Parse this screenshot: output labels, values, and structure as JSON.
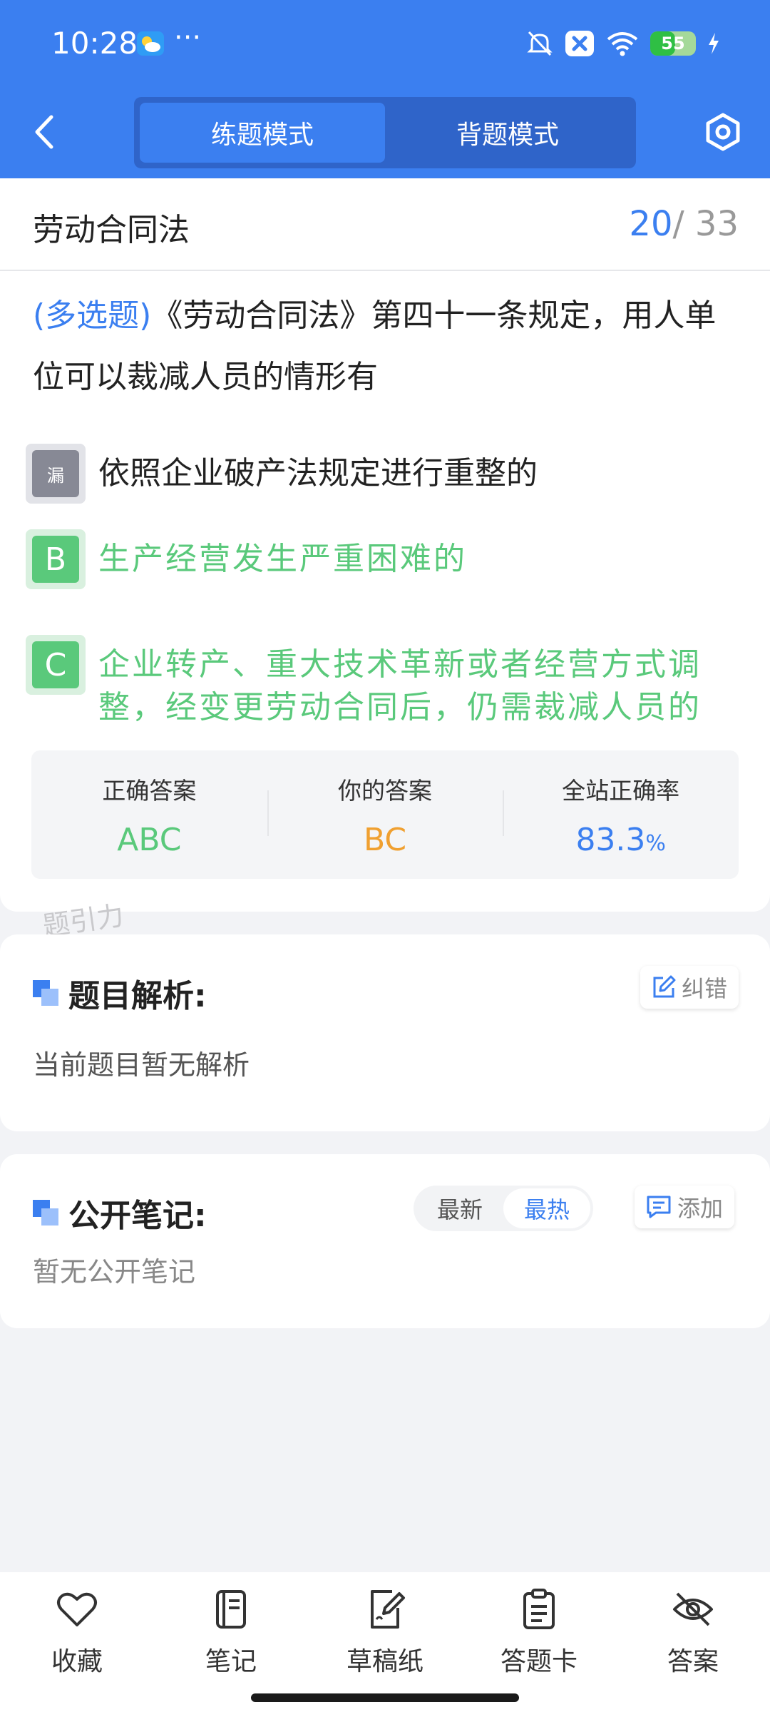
{
  "status_bar": {
    "time": "10:28",
    "dots": "···",
    "battery_level": "55",
    "battery_fraction": 0.55
  },
  "header": {
    "tabs": [
      {
        "label": "练题模式",
        "active": true
      },
      {
        "label": "背题模式",
        "active": false
      }
    ]
  },
  "section": {
    "title": "劳动合同法",
    "current": "20",
    "total": "/ 33"
  },
  "question": {
    "type": "(多选题)",
    "text": "《劳动合同法》第四十一条规定，用人单位可以裁减人员的情形有"
  },
  "options": [
    {
      "badge": "漏",
      "text": "依照企业破产法规定进行重整的",
      "state": "missed"
    },
    {
      "badge": "B",
      "text": "生产经营发生严重困难的",
      "state": "correct"
    },
    {
      "badge": "C",
      "text": "企业转产、重大技术革新或者经营方式调整，经变更劳动合同后，仍需裁减人员的",
      "state": "correct"
    }
  ],
  "answers": {
    "correct_label": "正确答案",
    "correct_value": "ABC",
    "yours_label": "你的答案",
    "yours_value": "BC",
    "rate_label": "全站正确率",
    "rate_value": "83.3",
    "rate_unit": "%"
  },
  "watermark": "题引力",
  "analysis": {
    "title": "题目解析:",
    "correct_button": "纠错",
    "body": "当前题目暂无解析"
  },
  "notes": {
    "title": "公开笔记:",
    "sort_options": [
      "最新",
      "最热"
    ],
    "active_sort": "最热",
    "add_button": "添加",
    "body": "暂无公开笔记"
  },
  "bottom_nav": [
    {
      "label": "收藏",
      "icon": "heart-icon"
    },
    {
      "label": "笔记",
      "icon": "notebook-icon"
    },
    {
      "label": "草稿纸",
      "icon": "draft-paper-icon"
    },
    {
      "label": "答题卡",
      "icon": "clipboard-icon"
    },
    {
      "label": "答案",
      "icon": "eye-off-icon"
    }
  ],
  "colors": {
    "primary": "#3b7ff0",
    "correct_green": "#5ac97b",
    "user_orange": "#f0a030",
    "missed_gray": "#878995"
  }
}
